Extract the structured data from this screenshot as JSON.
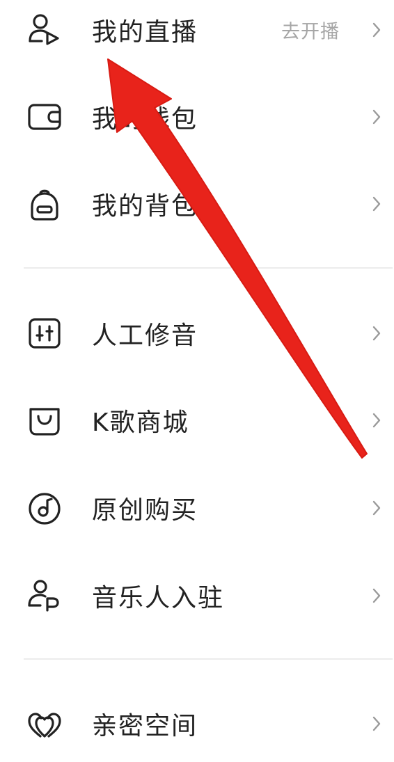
{
  "menu": {
    "section1": [
      {
        "label": "我的直播",
        "hint": "去开播",
        "icon": "live-user-icon"
      },
      {
        "label": "我的钱包",
        "icon": "wallet-icon"
      },
      {
        "label": "我的背包",
        "icon": "backpack-icon"
      }
    ],
    "section2": [
      {
        "label": "人工修音",
        "icon": "equalizer-icon"
      },
      {
        "label": "K歌商城",
        "icon": "shopping-bag-icon"
      },
      {
        "label": "原创购买",
        "icon": "music-disc-icon"
      },
      {
        "label": "音乐人入驻",
        "icon": "musician-icon"
      }
    ],
    "section3": [
      {
        "label": "亲密空间",
        "icon": "double-heart-icon"
      }
    ]
  },
  "overlay": {
    "annotation": "red-arrow",
    "color": "#e8231b"
  },
  "colors": {
    "text": "#222222",
    "hint": "#a6a6a6",
    "chevron": "#9a9a9a",
    "divider": "#ececec"
  }
}
